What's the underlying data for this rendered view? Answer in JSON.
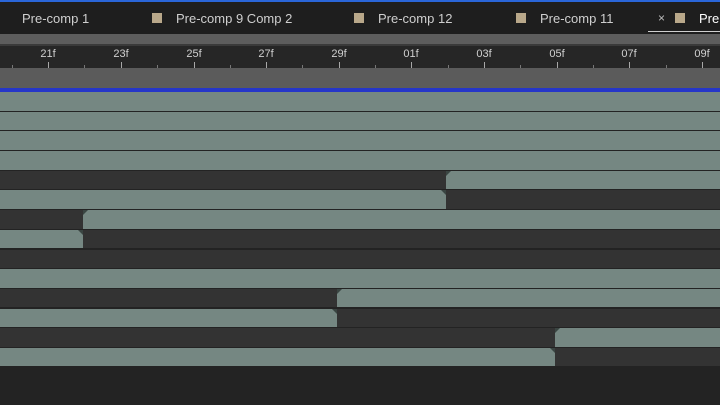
{
  "tabs": [
    {
      "label": "Pre-comp 1",
      "color": "#b9a88a",
      "active": false
    },
    {
      "label": "Pre-comp 9 Comp 2",
      "color": "#b9a88a",
      "active": false
    },
    {
      "label": "Pre-comp 12",
      "color": "#b9a88a",
      "active": false
    },
    {
      "label": "Pre-comp 11",
      "color": "#b9a88a",
      "active": false
    },
    {
      "label": "Pre",
      "color": "#b9a88a",
      "active": true
    }
  ],
  "close_symbol": "×",
  "ruler": {
    "labels": [
      "21f",
      "23f",
      "25f",
      "27f",
      "29f",
      "01f",
      "03f",
      "05f",
      "07f",
      "09f"
    ]
  },
  "colors": {
    "layer_bar": "#758782",
    "cache_line": "#2536c8",
    "tab_highlight": "#2a66d9"
  }
}
